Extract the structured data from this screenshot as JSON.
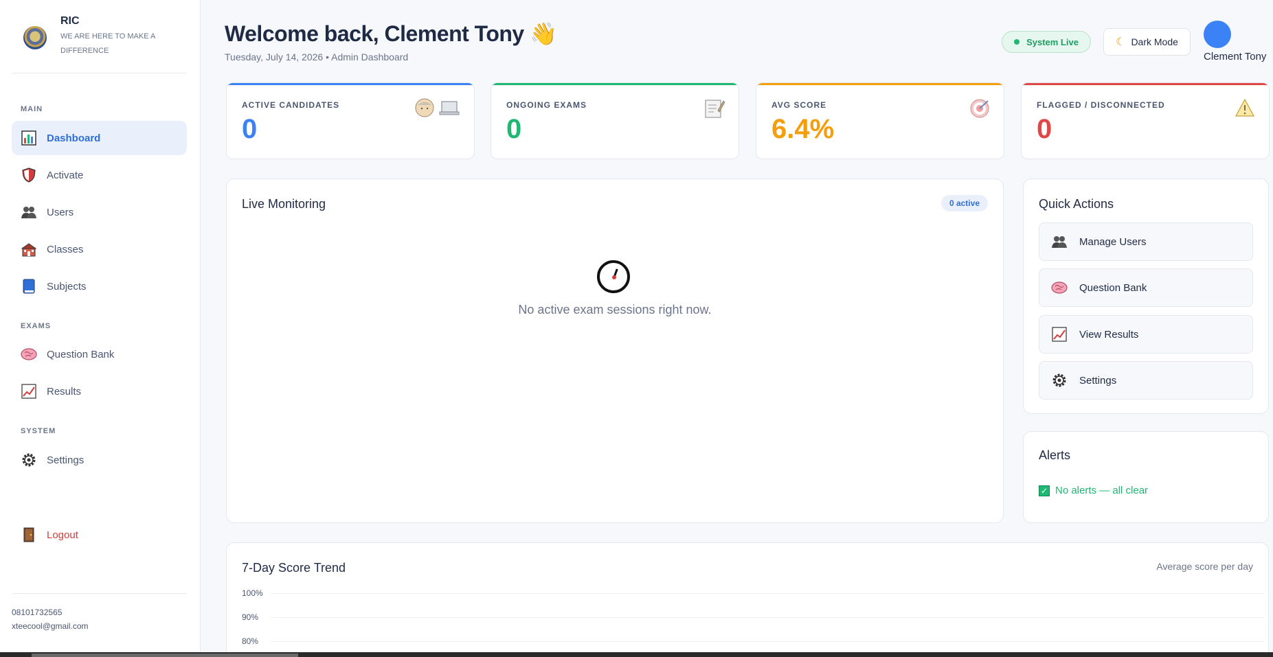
{
  "brand": {
    "name": "RIC",
    "tagline": "WE ARE HERE TO MAKE A DIFFERENCE"
  },
  "sidebar": {
    "sections": {
      "main": "MAIN",
      "exams": "EXAMS",
      "system": "SYSTEM"
    },
    "items": [
      {
        "label": "Dashboard",
        "icon": "bar-chart-icon"
      },
      {
        "label": "Activate",
        "icon": "shield-icon"
      },
      {
        "label": "Users",
        "icon": "users-icon"
      },
      {
        "label": "Classes",
        "icon": "school-icon"
      },
      {
        "label": "Subjects",
        "icon": "book-icon"
      },
      {
        "label": "Question Bank",
        "icon": "brain-icon"
      },
      {
        "label": "Results",
        "icon": "chart-increasing-icon"
      },
      {
        "label": "Settings",
        "icon": "gear-icon"
      }
    ],
    "logout": "Logout",
    "contact": {
      "phone": "08101732565",
      "email": "xteecool@gmail.com"
    }
  },
  "header": {
    "welcome": "Welcome back, Clement Tony 👋",
    "subtitle": "Tuesday, July 14, 2026 • Admin Dashboard",
    "system_status": "System Live",
    "dark_mode": "Dark Mode",
    "user_name": "Clement Tony"
  },
  "stats": [
    {
      "label": "ACTIVE CANDIDATES",
      "value": "0",
      "color": "#3b82f6"
    },
    {
      "label": "ONGOING EXAMS",
      "value": "0",
      "color": "#1fb873"
    },
    {
      "label": "AVG SCORE",
      "value": "6.4%",
      "color": "#f59e0b"
    },
    {
      "label": "FLAGGED / DISCONNECTED",
      "value": "0",
      "color": "#e04848"
    }
  ],
  "live_monitoring": {
    "title": "Live Monitoring",
    "badge": "0 active",
    "empty_text": "No active exam sessions right now."
  },
  "quick_actions": {
    "title": "Quick Actions",
    "items": [
      {
        "label": "Manage Users",
        "icon": "users-icon"
      },
      {
        "label": "Question Bank",
        "icon": "brain-icon"
      },
      {
        "label": "View Results",
        "icon": "chart-increasing-icon"
      },
      {
        "label": "Settings",
        "icon": "gear-icon"
      }
    ]
  },
  "alerts": {
    "title": "Alerts",
    "message": "No alerts — all clear"
  },
  "trend": {
    "title": "7-Day Score Trend",
    "subtitle": "Average score per day",
    "y_ticks": [
      "100%",
      "90%",
      "80%"
    ]
  }
}
